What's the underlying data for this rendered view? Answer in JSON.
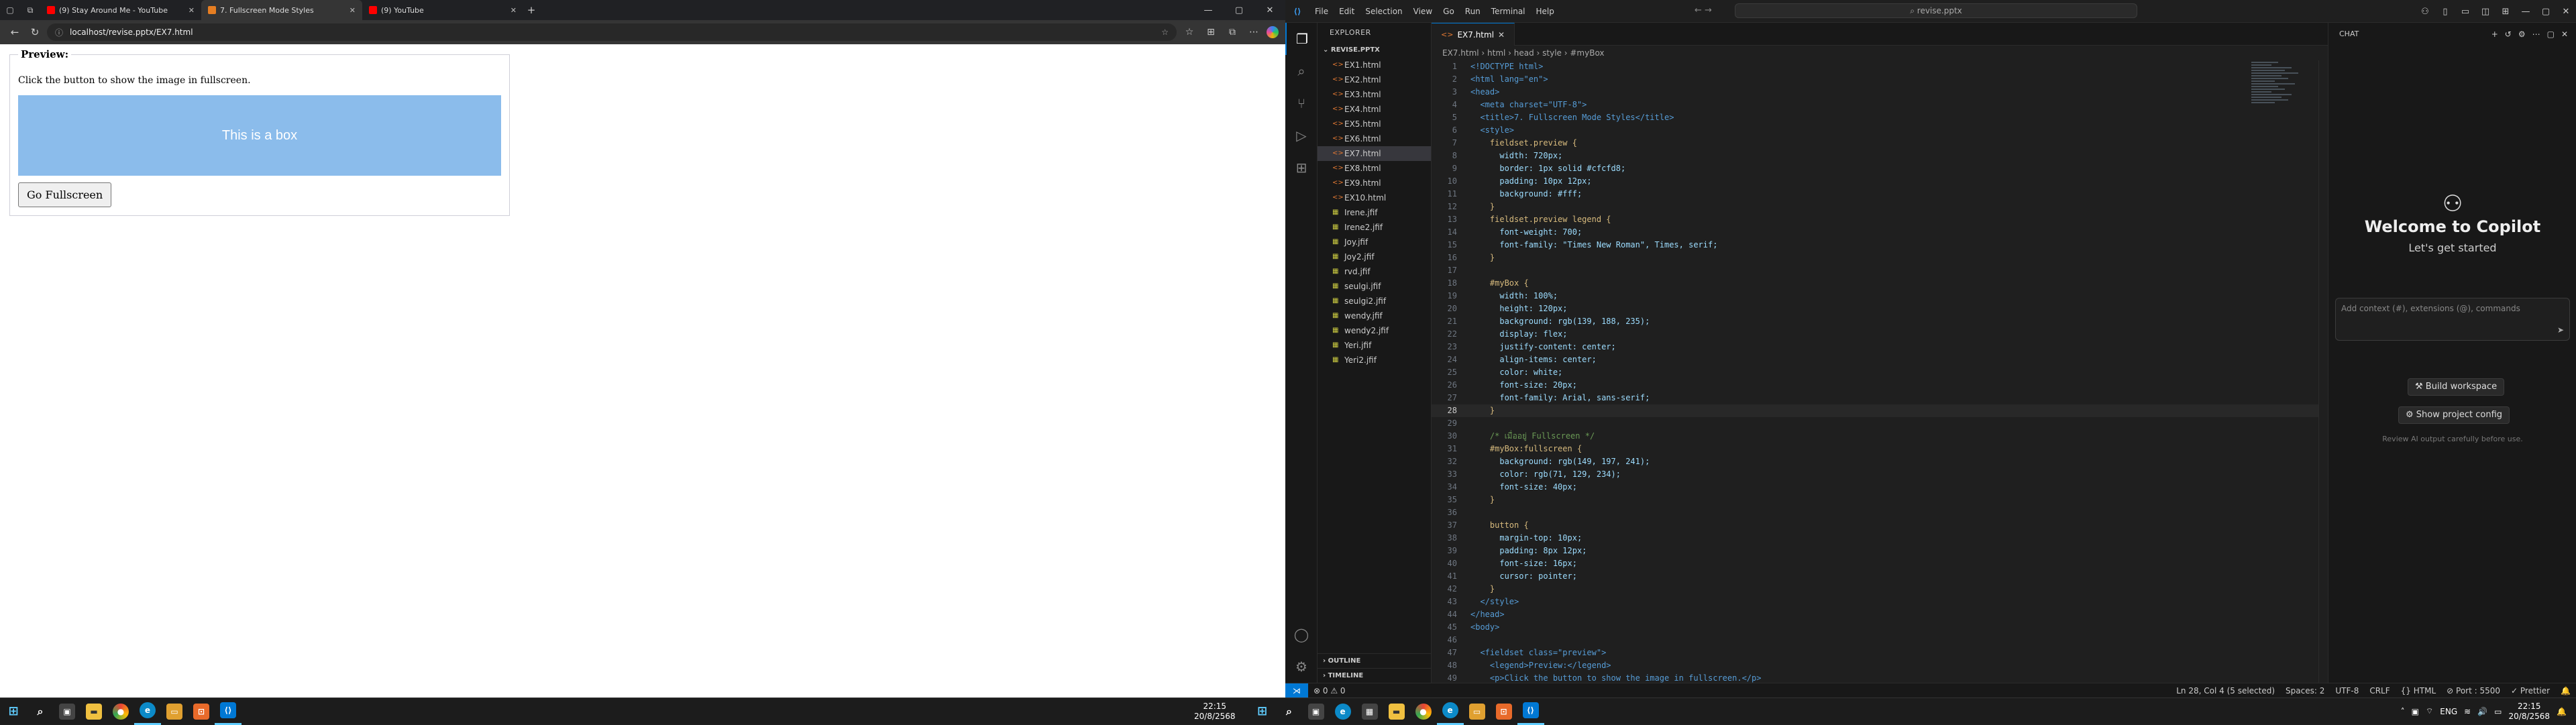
{
  "browser": {
    "tabs": [
      {
        "title": "(9) Stay Around Me - YouTube",
        "color": "#ff0000"
      },
      {
        "title": "7. Fullscreen Mode Styles",
        "color": "#e67e22"
      },
      {
        "title": "(9) YouTube",
        "color": "#ff0000"
      }
    ],
    "url": "localhost/revise.pptx/EX7.html",
    "page": {
      "legend": "Preview:",
      "paragraph": "Click the button to show the image in fullscreen.",
      "box_text": "This is a box",
      "button_label": "Go Fullscreen"
    }
  },
  "vscode": {
    "menu": [
      "File",
      "Edit",
      "Selection",
      "View",
      "Go",
      "Run",
      "Terminal",
      "Help"
    ],
    "search": "revise.pptx",
    "explorer_title": "EXPLORER",
    "folder": "REVISE.PPTX",
    "files": [
      {
        "name": "EX1.html",
        "type": "html"
      },
      {
        "name": "EX2.html",
        "type": "html"
      },
      {
        "name": "EX3.html",
        "type": "html"
      },
      {
        "name": "EX4.html",
        "type": "html"
      },
      {
        "name": "EX5.html",
        "type": "html"
      },
      {
        "name": "EX6.html",
        "type": "html"
      },
      {
        "name": "EX7.html",
        "type": "html",
        "active": true
      },
      {
        "name": "EX8.html",
        "type": "html"
      },
      {
        "name": "EX9.html",
        "type": "html"
      },
      {
        "name": "EX10.html",
        "type": "html"
      },
      {
        "name": "Irene.jfif",
        "type": "img"
      },
      {
        "name": "Irene2.jfif",
        "type": "img"
      },
      {
        "name": "Joy.jfif",
        "type": "img"
      },
      {
        "name": "Joy2.jfif",
        "type": "img"
      },
      {
        "name": "rvd.jfif",
        "type": "img"
      },
      {
        "name": "seulgi.jfif",
        "type": "img"
      },
      {
        "name": "seulgi2.jfif",
        "type": "img"
      },
      {
        "name": "wendy.jfif",
        "type": "img"
      },
      {
        "name": "wendy2.jfif",
        "type": "img"
      },
      {
        "name": "Yeri.jfif",
        "type": "img"
      },
      {
        "name": "Yeri2.jfif",
        "type": "img"
      }
    ],
    "sections": [
      "OUTLINE",
      "TIMELINE"
    ],
    "editor_tab": "EX7.html",
    "breadcrumbs": "EX7.html › html › head › style › #myBox",
    "code_lines": [
      "<!DOCTYPE html>",
      "<html lang=\"en\">",
      "<head>",
      "  <meta charset=\"UTF-8\">",
      "  <title>7. Fullscreen Mode Styles</title>",
      "  <style>",
      "    fieldset.preview {",
      "      width: 720px;",
      "      border: 1px solid #cfcfd8;",
      "      padding: 10px 12px;",
      "      background: #fff;",
      "    }",
      "    fieldset.preview legend {",
      "      font-weight: 700;",
      "      font-family: \"Times New Roman\", Times, serif;",
      "    }",
      "",
      "    #myBox {",
      "      width: 100%;",
      "      height: 120px;",
      "      background: rgb(139, 188, 235);",
      "      display: flex;",
      "      justify-content: center;",
      "      align-items: center;",
      "      color: white;",
      "      font-size: 20px;",
      "      font-family: Arial, sans-serif;",
      "    }",
      "",
      "    /* เมื่ออยู่ Fullscreen */",
      "    #myBox:fullscreen {",
      "      background: rgb(149, 197, 241);",
      "      color: rgb(71, 129, 234);",
      "      font-size: 40px;",
      "    }",
      "",
      "    button {",
      "      margin-top: 10px;",
      "      padding: 8px 12px;",
      "      font-size: 16px;",
      "      cursor: pointer;",
      "    }",
      "  </style>",
      "</head>",
      "<body>",
      "",
      "  <fieldset class=\"preview\">",
      "    <legend>Preview:</legend>",
      "    <p>Click the button to show the image in fullscreen.</p>"
    ],
    "current_line": 28,
    "chat": {
      "header": "CHAT",
      "welcome": "Welcome to Copilot",
      "subtitle": "Let's get started",
      "placeholder": "Add context (#), extensions (@), commands",
      "build_btn": "Build workspace",
      "config_btn": "Show project config",
      "note": "Review AI output carefully before use."
    },
    "status": {
      "errors": "0",
      "warnings": "0",
      "position": "Ln 28, Col 4 (5 selected)",
      "spaces": "Spaces: 2",
      "encoding": "UTF-8",
      "eol": "CRLF",
      "lang": "HTML",
      "port": "Port : 5500",
      "prettier": "Prettier"
    }
  },
  "taskbar": {
    "time_left": "22:15",
    "date_left": "20/8/2568",
    "time_right": "22:15",
    "date_right": "20/8/2568",
    "lang": "ENG"
  }
}
